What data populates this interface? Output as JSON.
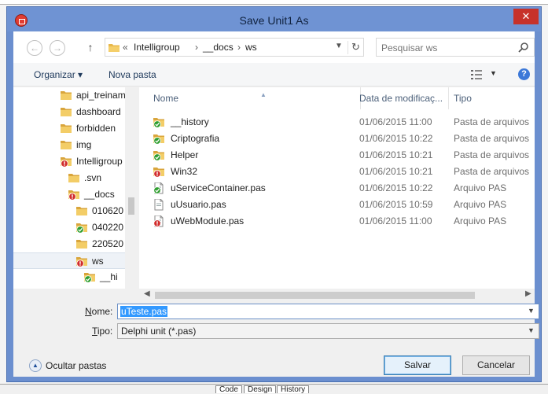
{
  "dialog": {
    "title": "Save Unit1 As",
    "close_label": "✕"
  },
  "address": {
    "overflow": "«",
    "crumbs": [
      "Intelligroup",
      "__docs",
      "ws"
    ],
    "separator": "›"
  },
  "search": {
    "placeholder": "Pesquisar ws"
  },
  "toolbar": {
    "organize_label": "Organizar ▾",
    "new_folder_label": "Nova pasta",
    "help_label": "?"
  },
  "tree": {
    "items": [
      {
        "label": "api_treinamento",
        "icon": "folder"
      },
      {
        "label": "dashboard",
        "icon": "folder"
      },
      {
        "label": "forbidden",
        "icon": "folder"
      },
      {
        "label": "img",
        "icon": "folder"
      },
      {
        "label": "Intelligroup",
        "icon": "folder-conflict"
      },
      {
        "label": ".svn",
        "icon": "folder"
      },
      {
        "label": "__docs",
        "icon": "folder-conflict"
      },
      {
        "label": "010620",
        "icon": "folder"
      },
      {
        "label": "040220",
        "icon": "folder-ok"
      },
      {
        "label": "220520",
        "icon": "folder"
      },
      {
        "label": "ws",
        "icon": "folder-conflict"
      },
      {
        "label": "__hi",
        "icon": "folder-ok"
      }
    ]
  },
  "columns": {
    "name": "Nome",
    "date": "Data de modificaç...",
    "type": "Tipo"
  },
  "files": [
    {
      "name": "__history",
      "date": "01/06/2015 11:00",
      "type": "Pasta de arquivos",
      "icon": "folder-ok"
    },
    {
      "name": "Criptografia",
      "date": "01/06/2015 10:22",
      "type": "Pasta de arquivos",
      "icon": "folder-ok"
    },
    {
      "name": "Helper",
      "date": "01/06/2015 10:21",
      "type": "Pasta de arquivos",
      "icon": "folder-ok"
    },
    {
      "name": "Win32",
      "date": "01/06/2015 10:21",
      "type": "Pasta de arquivos",
      "icon": "folder-conflict"
    },
    {
      "name": "uServiceContainer.pas",
      "date": "01/06/2015 10:22",
      "type": "Arquivo PAS",
      "icon": "file-ok"
    },
    {
      "name": "uUsuario.pas",
      "date": "01/06/2015 10:59",
      "type": "Arquivo PAS",
      "icon": "file"
    },
    {
      "name": "uWebModule.pas",
      "date": "01/06/2015 11:00",
      "type": "Arquivo PAS",
      "icon": "file-conflict"
    }
  ],
  "form": {
    "name_label_u": "N",
    "name_label_rest": "ome:",
    "name_value": "uTeste.pas",
    "type_label_u": "T",
    "type_label_rest": "ipo:",
    "type_value": "Delphi unit (*.pas)"
  },
  "footer": {
    "hide_folders_label": "Ocultar pastas",
    "save_label": "Salvar",
    "cancel_label": "Cancelar"
  },
  "ide": {
    "tabs": [
      "Code",
      "Design",
      "History"
    ]
  },
  "colors": {
    "titlebar": "#6f93d3",
    "close": "#c7322a",
    "selection": "#3399ff",
    "ok_overlay": "#2f9e2f",
    "conflict_overlay": "#d12d2d"
  }
}
